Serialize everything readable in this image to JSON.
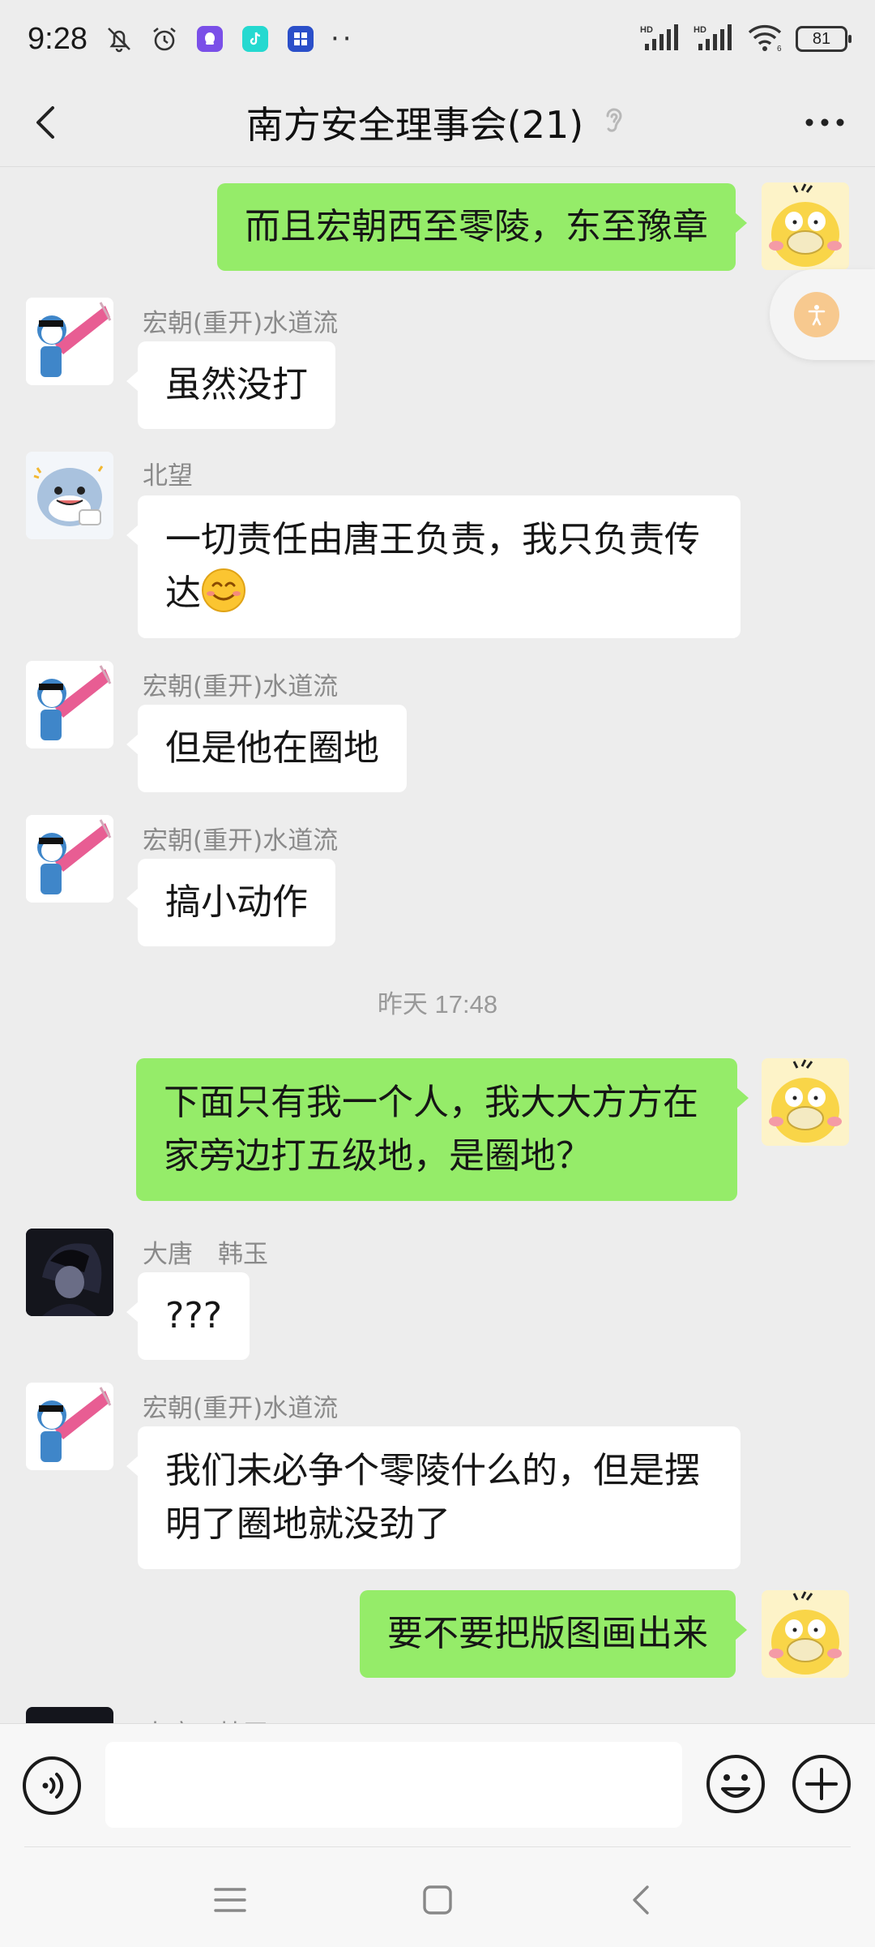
{
  "status_bar": {
    "time": "9:28",
    "more_dots": "··",
    "battery": "81",
    "signal_label": "HD"
  },
  "header": {
    "title": "南方安全理事会(21)"
  },
  "messages": [
    {
      "direction": "out",
      "text": "而且宏朝西至零陵，东至豫章"
    },
    {
      "direction": "in",
      "sender": "宏朝(重开)水道流",
      "text": "虽然没打"
    },
    {
      "direction": "in",
      "sender": "北望",
      "text_line1": "一切责任由唐王负责，我只负责传",
      "text_line2": "达"
    },
    {
      "direction": "in",
      "sender": "宏朝(重开)水道流",
      "text": "但是他在圈地"
    },
    {
      "direction": "in",
      "sender": "宏朝(重开)水道流",
      "text": "搞小动作"
    },
    {
      "type": "timestamp",
      "text": "昨天 17:48"
    },
    {
      "direction": "out",
      "text_line1": "下面只有我一个人，我大大方方在",
      "text_line2": "家旁边打五级地，是圈地？"
    },
    {
      "direction": "in",
      "sender": "大唐　韩玉",
      "text": "???"
    },
    {
      "direction": "in",
      "sender": "宏朝(重开)水道流",
      "text_line1": "我们未必争个零陵什么的，但是摆",
      "text_line2": "明了圈地就没劲了"
    },
    {
      "direction": "out",
      "text": "要不要把版图画出来"
    },
    {
      "direction": "in",
      "sender": "大唐　韩玉"
    }
  ],
  "colors": {
    "background": "#ededed",
    "bubble_out": "#95ec69",
    "bubble_in": "#ffffff",
    "sender_name": "#8a8a8a"
  },
  "icons": {
    "back": "chevron-left-icon",
    "ear": "ear-icon",
    "more": "more-dots-icon",
    "voice": "voice-icon",
    "emoji": "emoji-icon",
    "plus": "plus-icon",
    "accessibility": "accessibility-icon"
  }
}
